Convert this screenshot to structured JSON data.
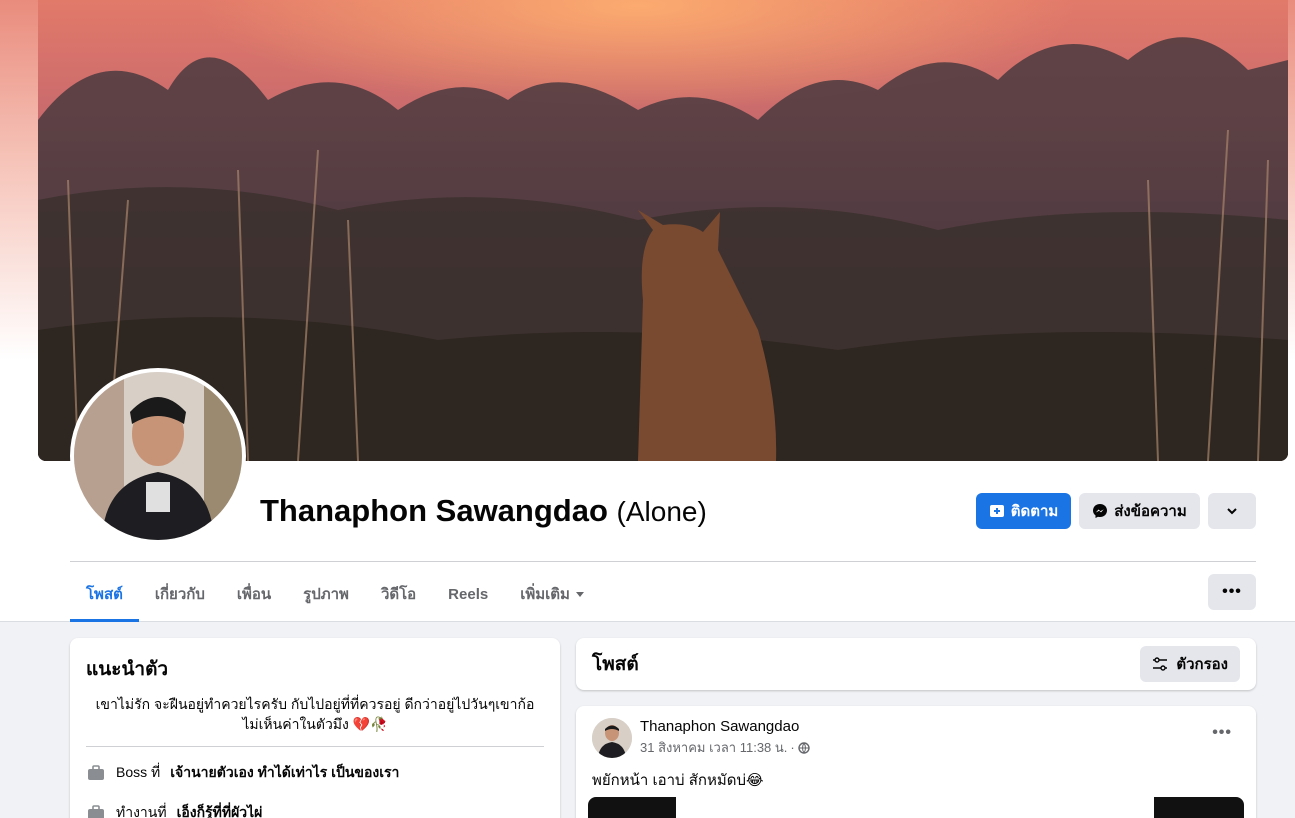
{
  "profile": {
    "name": "Thanaphon Sawangdao",
    "alternate_name": "(Alone)"
  },
  "actions": {
    "follow_label": "ติดตาม",
    "message_label": "ส่งข้อความ"
  },
  "tabs": [
    {
      "label": "โพสต์",
      "active": true
    },
    {
      "label": "เกี่ยวกับ"
    },
    {
      "label": "เพื่อน"
    },
    {
      "label": "รูปภาพ"
    },
    {
      "label": "วิดีโอ"
    },
    {
      "label": "Reels"
    },
    {
      "label": "เพิ่มเติม"
    }
  ],
  "intro": {
    "title": "แนะนำตัว",
    "bio": "เขาไม่รัก จะฝืนอยู่ทำควยไรครับ กับไปอยู่ที่ที่ควรอยู่ ดีกว่าอยู่ไปวันๆเขาก้อไม่เห็นค่าในตัวมึง 💔🥀",
    "rows": [
      {
        "prefix": "Boss ที่",
        "bold": "เจ้านายตัวเอง ทำได้เท่าไร เป็นของเรา"
      },
      {
        "prefix": "ทำงานที่",
        "bold": "เอ็งก็รู้ที่ที่ผัวไผ่"
      }
    ]
  },
  "posts_section": {
    "title": "โพสต์",
    "filter_label": "ตัวกรอง"
  },
  "post": {
    "author": "Thanaphon Sawangdao",
    "timestamp": "31 สิงหาคม เวลา 11:38 น.",
    "separator": "·",
    "text": "พยักหน้า  เอาบ่ สักหมัดบ่😂"
  },
  "colors": {
    "accent": "#1b74e4",
    "secondary_button": "#e4e6eb",
    "page_background": "#f0f2f5"
  }
}
